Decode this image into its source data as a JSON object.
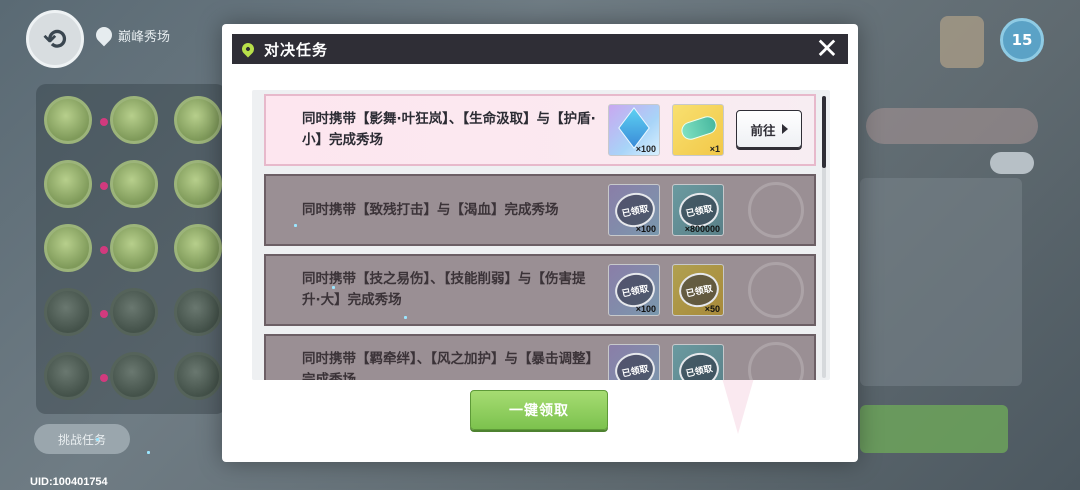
{
  "background": {
    "location_label": "巅峰秀场",
    "uid_text": "UID:100401754",
    "left_pill_label": "挑战任务",
    "top_badge": "15"
  },
  "modal": {
    "title": "对决任务",
    "claim_all_label": "一键领取",
    "tasks": [
      {
        "text": "同时携带【影舞·叶狂岚】、【生命汲取】与【护盾·小】完成秀场",
        "state": "active",
        "rewards": [
          {
            "icon": "crystal-icon",
            "count": "×100",
            "claimed": false
          },
          {
            "icon": "ticket-icon",
            "count": "×1",
            "claimed": false
          }
        ],
        "action_label": "前往"
      },
      {
        "text": "同时携带【致残打击】与【渴血】完成秀场",
        "state": "claimed",
        "rewards": [
          {
            "icon": "crystal-icon",
            "count": "×100",
            "claimed": true,
            "stamp": "已领取"
          },
          {
            "icon": "coin-icon",
            "count": "×800000",
            "claimed": true,
            "stamp": "已领取"
          }
        ]
      },
      {
        "text": "同时携带【技之易伤】、【技能削弱】与【伤害提升·大】完成秀场",
        "state": "claimed",
        "rewards": [
          {
            "icon": "crystal-icon",
            "count": "×100",
            "claimed": true,
            "stamp": "已领取"
          },
          {
            "icon": "ticket-icon",
            "count": "×50",
            "claimed": true,
            "stamp": "已领取"
          }
        ]
      },
      {
        "text": "同时携带【羁牵绊】、【风之加护】与【暴击调整】完成秀场",
        "state": "claimed",
        "rewards": [
          {
            "icon": "crystal-icon",
            "count": "",
            "claimed": true,
            "stamp": "已领取"
          },
          {
            "icon": "coin-icon",
            "count": "",
            "claimed": true,
            "stamp": "已领取"
          }
        ]
      }
    ]
  }
}
